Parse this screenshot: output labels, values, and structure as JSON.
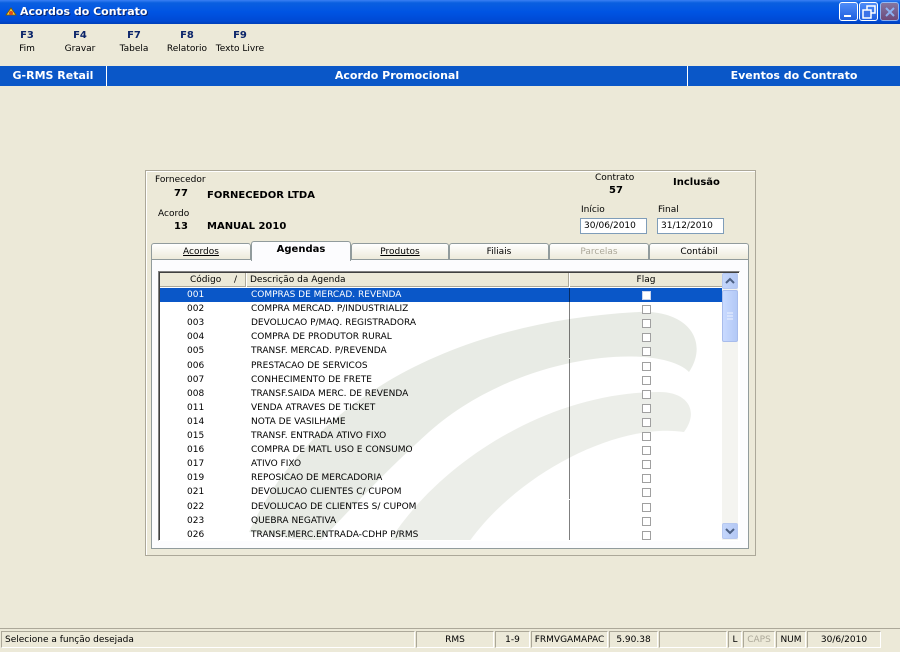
{
  "window": {
    "title": "Acordos do Contrato",
    "icon": "app-icon"
  },
  "fkeys": [
    {
      "key": "F3",
      "label": "Fim"
    },
    {
      "key": "F4",
      "label": "Gravar"
    },
    {
      "key": "F7",
      "label": "Tabela"
    },
    {
      "key": "F8",
      "label": "Relatorio"
    },
    {
      "key": "F9",
      "label": "Texto Livre"
    }
  ],
  "header": {
    "left": "G-RMS Retail",
    "center": "Acordo Promocional",
    "right": "Eventos do Contrato"
  },
  "form": {
    "fornecedor_label": "Fornecedor",
    "fornecedor_code": "77",
    "fornecedor_name": "FORNECEDOR LTDA",
    "acordo_label": "Acordo",
    "acordo_code": "13",
    "acordo_name": "MANUAL 2010",
    "contrato_label": "Contrato",
    "contrato_value": "57",
    "mode": "Inclusão",
    "inicio_label": "Início",
    "inicio_value": "30/06/2010",
    "final_label": "Final",
    "final_value": "31/12/2010"
  },
  "tabs": [
    {
      "label": "Acordos",
      "state": "normal"
    },
    {
      "label": "Agendas",
      "state": "active"
    },
    {
      "label": "Produtos",
      "state": "normal"
    },
    {
      "label": "Filiais",
      "state": "normal"
    },
    {
      "label": "Parcelas",
      "state": "disabled"
    },
    {
      "label": "Contábil",
      "state": "normal"
    }
  ],
  "grid": {
    "columns": {
      "codigo": "Código",
      "sort_mark": "/",
      "descricao": "Descrição da Agenda",
      "flag": "Flag"
    },
    "rows": [
      {
        "codigo": "001",
        "descricao": "COMPRAS DE MERCAD. REVENDA"
      },
      {
        "codigo": "002",
        "descricao": "COMPRA MERCAD. P/INDUSTRIALIZ"
      },
      {
        "codigo": "003",
        "descricao": "DEVOLUCAO P/MAQ. REGISTRADORA"
      },
      {
        "codigo": "004",
        "descricao": "COMPRA DE PRODUTOR RURAL"
      },
      {
        "codigo": "005",
        "descricao": "TRANSF. MERCAD. P/REVENDA"
      },
      {
        "codigo": "006",
        "descricao": "PRESTACAO DE SERVICOS"
      },
      {
        "codigo": "007",
        "descricao": "CONHECIMENTO DE FRETE"
      },
      {
        "codigo": "008",
        "descricao": "TRANSF.SAIDA MERC. DE REVENDA"
      },
      {
        "codigo": "011",
        "descricao": "VENDA ATRAVES DE TICKET"
      },
      {
        "codigo": "014",
        "descricao": "NOTA DE VASILHAME"
      },
      {
        "codigo": "015",
        "descricao": "TRANSF. ENTRADA ATIVO FIXO"
      },
      {
        "codigo": "016",
        "descricao": "COMPRA DE MATL USO E CONSUMO"
      },
      {
        "codigo": "017",
        "descricao": "ATIVO FIXO"
      },
      {
        "codigo": "019",
        "descricao": "REPOSICAO DE MERCADORIA"
      },
      {
        "codigo": "021",
        "descricao": "DEVOLUCAO CLIENTES C/ CUPOM"
      },
      {
        "codigo": "022",
        "descricao": "DEVOLUCAO DE CLIENTES S/ CUPOM"
      },
      {
        "codigo": "023",
        "descricao": "QUEBRA NEGATIVA"
      },
      {
        "codigo": "026",
        "descricao": "TRANSF.MERC.ENTRADA-CDHP P/RMS"
      }
    ],
    "selected_index": 0
  },
  "status": {
    "message": "Selecione a função desejada",
    "system": "RMS",
    "range": "1-9",
    "form": "FRMVGAMAPAC",
    "version": "5.90.38",
    "blank": "",
    "l": "L",
    "caps": "CAPS",
    "num": "NUM",
    "date": "30/6/2010"
  },
  "colors": {
    "accent": "#0a57c8",
    "titlebar": "#0054e3"
  }
}
